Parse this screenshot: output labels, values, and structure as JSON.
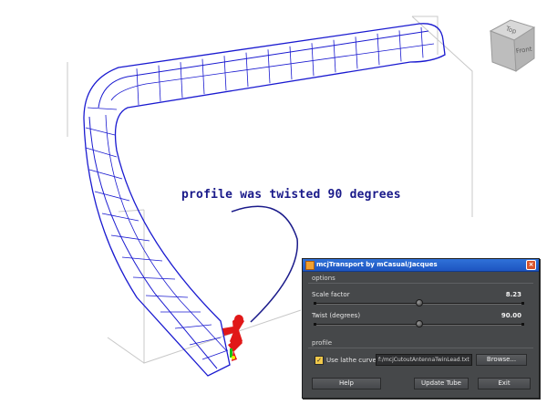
{
  "scene": {
    "annotation": "profile was twisted 90 degrees"
  },
  "viewcube": {
    "top_face": "Top",
    "front_face": "Front"
  },
  "dialog": {
    "title": "mcjTransport by mCasual/Jacques",
    "options_group": "options",
    "scale_label": "Scale factor",
    "scale_value": "8.23",
    "scale_fraction": 0.5,
    "twist_label": "Twist (degrees)",
    "twist_value": "90.00",
    "twist_fraction": 0.5,
    "profile_group": "profile",
    "lathe_checkbox_label": "Use lathe curve",
    "lathe_checked": true,
    "lathe_path": "f:/mcjCutoutAntennaTwinLead.txt",
    "browse_label": "Browse...",
    "help_label": "Help",
    "update_label": "Update Tube",
    "exit_label": "Exit"
  },
  "colors": {
    "wireframe": "#1a1ad0",
    "annotation": "#1a1a8a",
    "titlebar": "#2a63cf",
    "checkbox": "#f2c94a"
  },
  "icons": {
    "close": "close-icon",
    "app": "app-icon",
    "checkmark": "checkmark-icon"
  }
}
